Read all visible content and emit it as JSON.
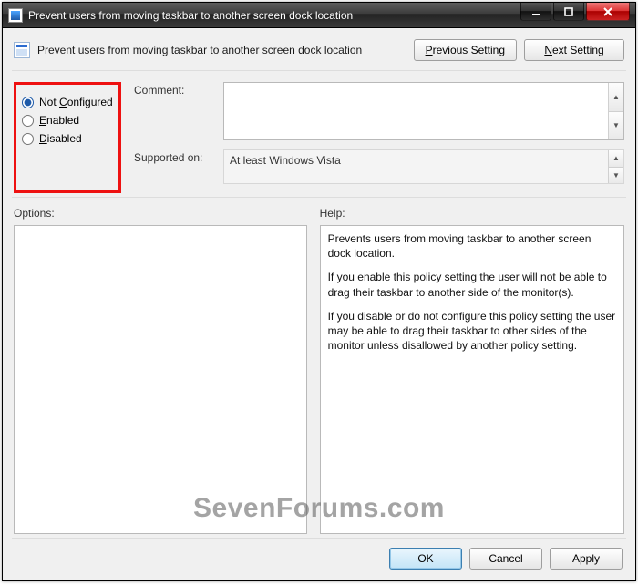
{
  "window": {
    "title": "Prevent users from moving taskbar to another screen dock location"
  },
  "header": {
    "policy_title": "Prevent users from moving taskbar to another screen dock location",
    "prev_label": "Previous Setting",
    "next_label": "Next Setting"
  },
  "state": {
    "options": [
      {
        "key": "not_configured",
        "label": "Not Configured",
        "underline": "C",
        "checked": true
      },
      {
        "key": "enabled",
        "label": "Enabled",
        "underline": "E",
        "checked": false
      },
      {
        "key": "disabled",
        "label": "Disabled",
        "underline": "D",
        "checked": false
      }
    ]
  },
  "fields": {
    "comment_label": "Comment:",
    "comment_value": "",
    "supported_label": "Supported on:",
    "supported_value": "At least Windows Vista"
  },
  "panes": {
    "options_label": "Options:",
    "help_label": "Help:",
    "help_text": "Prevents users from moving taskbar to another screen dock location.\n\nIf you enable this policy setting the user will not be able to drag their taskbar to another side of the monitor(s).\n\nIf you disable or do not configure this policy setting the user may be able to drag their taskbar to other sides of the monitor unless disallowed by another policy setting."
  },
  "footer": {
    "ok": "OK",
    "cancel": "Cancel",
    "apply": "Apply"
  },
  "watermark": "SevenForums.com"
}
